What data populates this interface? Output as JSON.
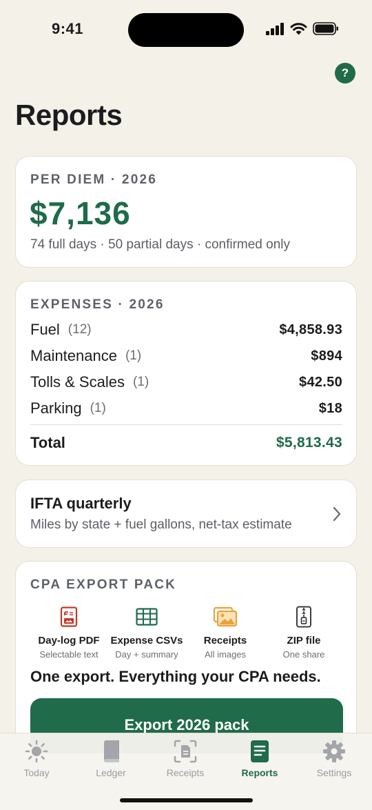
{
  "status": {
    "time": "9:41"
  },
  "header": {
    "title": "Reports",
    "help_label": "?"
  },
  "per_diem": {
    "eyebrow": "PER DIEM · 2026",
    "amount": "$7,136",
    "subtitle": "74 full days · 50 partial days · confirmed only"
  },
  "expenses": {
    "eyebrow": "EXPENSES · 2026",
    "rows": [
      {
        "label": "Fuel",
        "count": "(12)",
        "amount": "$4,858.93"
      },
      {
        "label": "Maintenance",
        "count": "(1)",
        "amount": "$894"
      },
      {
        "label": "Tolls & Scales",
        "count": "(1)",
        "amount": "$42.50"
      },
      {
        "label": "Parking",
        "count": "(1)",
        "amount": "$18"
      }
    ],
    "total_label": "Total",
    "total_amount": "$5,813.43"
  },
  "ifta": {
    "title": "IFTA quarterly",
    "subtitle": "Miles by state + fuel gallons, net-tax estimate",
    "chevron_icon": "chevron-right-icon"
  },
  "cpa": {
    "eyebrow": "CPA EXPORT PACK",
    "features": [
      {
        "icon": "pdf-icon",
        "title": "Day-log PDF",
        "subtitle": "Selectable text"
      },
      {
        "icon": "spreadsheet-icon",
        "title": "Expense CSVs",
        "subtitle": "Day + summary"
      },
      {
        "icon": "images-icon",
        "title": "Receipts",
        "subtitle": "All images"
      },
      {
        "icon": "zip-icon",
        "title": "ZIP file",
        "subtitle": "One share"
      }
    ],
    "tagline": "One export. Everything your CPA needs.",
    "button_label": "Export 2026 pack"
  },
  "tabs": [
    {
      "label": "Today",
      "icon": "sun-icon",
      "active": false
    },
    {
      "label": "Ledger",
      "icon": "book-icon",
      "active": false
    },
    {
      "label": "Receipts",
      "icon": "receipt-scan-icon",
      "active": false
    },
    {
      "label": "Reports",
      "icon": "report-icon",
      "active": true
    },
    {
      "label": "Settings",
      "icon": "gear-icon",
      "active": false
    }
  ],
  "colors": {
    "accent": "#1f6b4a",
    "background": "#f4f1e9",
    "pdf": "#c0392b",
    "images": "#e8a23a"
  }
}
